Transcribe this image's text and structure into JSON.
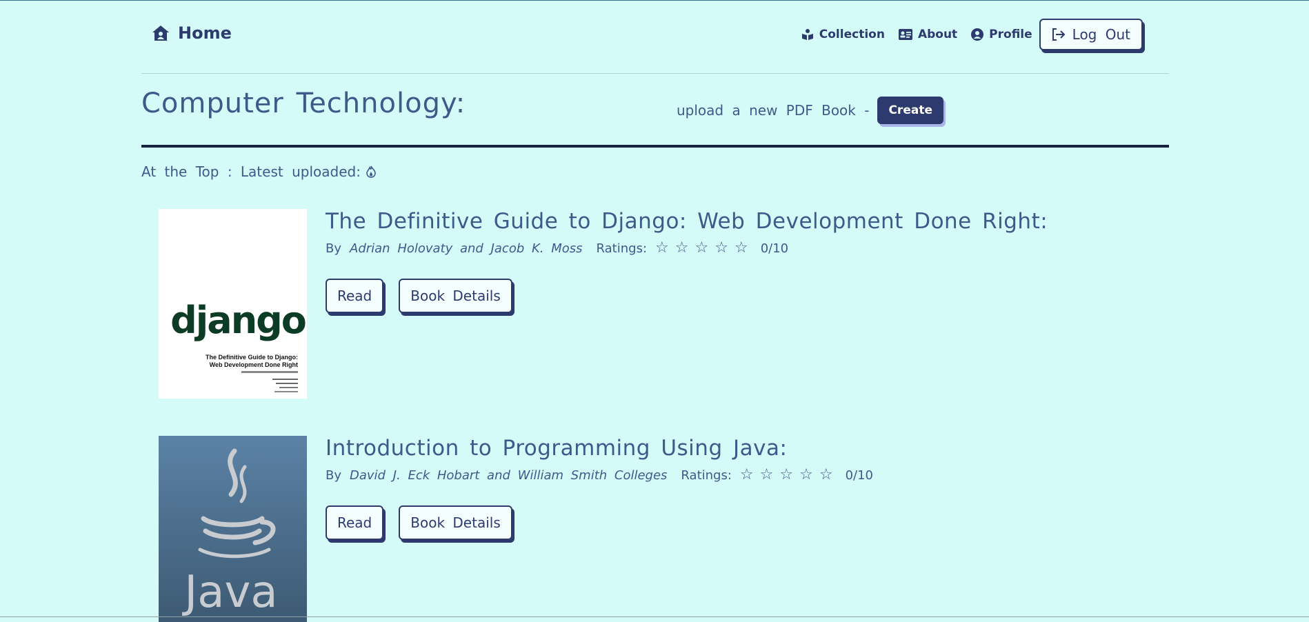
{
  "nav": {
    "brand": "Home",
    "links": [
      {
        "label": "Collection",
        "icon": "book-reader-icon"
      },
      {
        "label": "About",
        "icon": "id-card-icon"
      },
      {
        "label": "Profile",
        "icon": "user-circle-icon"
      }
    ],
    "logout": "Log Out"
  },
  "header": {
    "title": "Computer Technology:",
    "upload_text": "upload a new PDF Book -",
    "create_label": "Create"
  },
  "latest_label": "At the Top : Latest uploaded:",
  "books": [
    {
      "title": "The Definitive Guide to Django: Web Development Done Right:",
      "by": "By",
      "author": "Adrian Holovaty and Jacob K. Moss",
      "ratings_label": "Ratings:",
      "score": "0/10",
      "read_label": "Read",
      "details_label": "Book Details",
      "cover": {
        "logo": "django",
        "line1": "The Definitive Guide to Django:",
        "line2": "Web Development Done Right"
      }
    },
    {
      "title": "Introduction to Programming Using Java:",
      "by": "By",
      "author": "David J. Eck Hobart and William Smith Colleges",
      "ratings_label": "Ratings:",
      "score": "0/10",
      "read_label": "Read",
      "details_label": "Book Details",
      "cover": {
        "logo": "Java"
      }
    }
  ],
  "colors": {
    "background": "#d4fbf8",
    "primary": "#2c3a6e",
    "heading": "#3c5a8a"
  }
}
